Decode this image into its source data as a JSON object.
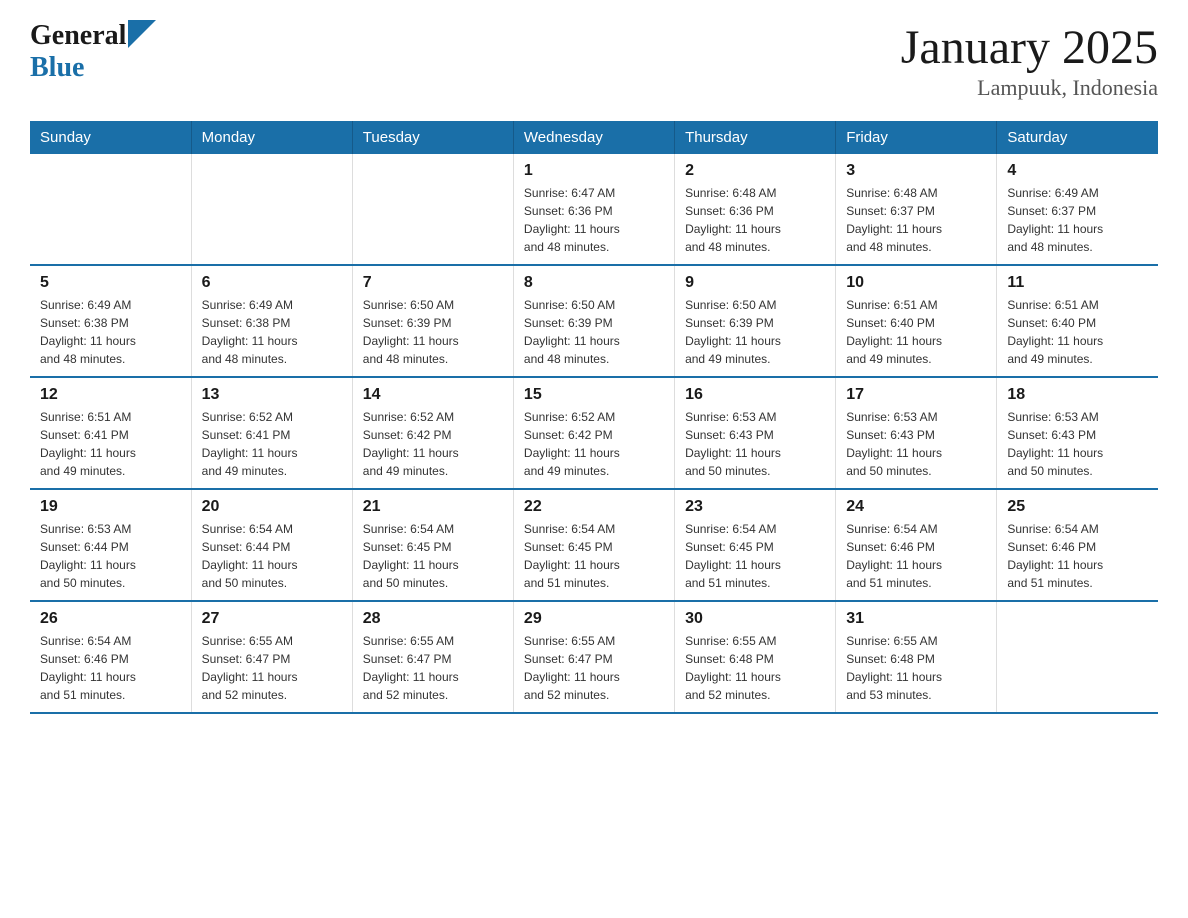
{
  "logo": {
    "general": "General",
    "blue": "Blue"
  },
  "header": {
    "title": "January 2025",
    "subtitle": "Lampuuk, Indonesia"
  },
  "weekdays": [
    "Sunday",
    "Monday",
    "Tuesday",
    "Wednesday",
    "Thursday",
    "Friday",
    "Saturday"
  ],
  "weeks": [
    [
      {
        "day": "",
        "info": ""
      },
      {
        "day": "",
        "info": ""
      },
      {
        "day": "",
        "info": ""
      },
      {
        "day": "1",
        "info": "Sunrise: 6:47 AM\nSunset: 6:36 PM\nDaylight: 11 hours\nand 48 minutes."
      },
      {
        "day": "2",
        "info": "Sunrise: 6:48 AM\nSunset: 6:36 PM\nDaylight: 11 hours\nand 48 minutes."
      },
      {
        "day": "3",
        "info": "Sunrise: 6:48 AM\nSunset: 6:37 PM\nDaylight: 11 hours\nand 48 minutes."
      },
      {
        "day": "4",
        "info": "Sunrise: 6:49 AM\nSunset: 6:37 PM\nDaylight: 11 hours\nand 48 minutes."
      }
    ],
    [
      {
        "day": "5",
        "info": "Sunrise: 6:49 AM\nSunset: 6:38 PM\nDaylight: 11 hours\nand 48 minutes."
      },
      {
        "day": "6",
        "info": "Sunrise: 6:49 AM\nSunset: 6:38 PM\nDaylight: 11 hours\nand 48 minutes."
      },
      {
        "day": "7",
        "info": "Sunrise: 6:50 AM\nSunset: 6:39 PM\nDaylight: 11 hours\nand 48 minutes."
      },
      {
        "day": "8",
        "info": "Sunrise: 6:50 AM\nSunset: 6:39 PM\nDaylight: 11 hours\nand 48 minutes."
      },
      {
        "day": "9",
        "info": "Sunrise: 6:50 AM\nSunset: 6:39 PM\nDaylight: 11 hours\nand 49 minutes."
      },
      {
        "day": "10",
        "info": "Sunrise: 6:51 AM\nSunset: 6:40 PM\nDaylight: 11 hours\nand 49 minutes."
      },
      {
        "day": "11",
        "info": "Sunrise: 6:51 AM\nSunset: 6:40 PM\nDaylight: 11 hours\nand 49 minutes."
      }
    ],
    [
      {
        "day": "12",
        "info": "Sunrise: 6:51 AM\nSunset: 6:41 PM\nDaylight: 11 hours\nand 49 minutes."
      },
      {
        "day": "13",
        "info": "Sunrise: 6:52 AM\nSunset: 6:41 PM\nDaylight: 11 hours\nand 49 minutes."
      },
      {
        "day": "14",
        "info": "Sunrise: 6:52 AM\nSunset: 6:42 PM\nDaylight: 11 hours\nand 49 minutes."
      },
      {
        "day": "15",
        "info": "Sunrise: 6:52 AM\nSunset: 6:42 PM\nDaylight: 11 hours\nand 49 minutes."
      },
      {
        "day": "16",
        "info": "Sunrise: 6:53 AM\nSunset: 6:43 PM\nDaylight: 11 hours\nand 50 minutes."
      },
      {
        "day": "17",
        "info": "Sunrise: 6:53 AM\nSunset: 6:43 PM\nDaylight: 11 hours\nand 50 minutes."
      },
      {
        "day": "18",
        "info": "Sunrise: 6:53 AM\nSunset: 6:43 PM\nDaylight: 11 hours\nand 50 minutes."
      }
    ],
    [
      {
        "day": "19",
        "info": "Sunrise: 6:53 AM\nSunset: 6:44 PM\nDaylight: 11 hours\nand 50 minutes."
      },
      {
        "day": "20",
        "info": "Sunrise: 6:54 AM\nSunset: 6:44 PM\nDaylight: 11 hours\nand 50 minutes."
      },
      {
        "day": "21",
        "info": "Sunrise: 6:54 AM\nSunset: 6:45 PM\nDaylight: 11 hours\nand 50 minutes."
      },
      {
        "day": "22",
        "info": "Sunrise: 6:54 AM\nSunset: 6:45 PM\nDaylight: 11 hours\nand 51 minutes."
      },
      {
        "day": "23",
        "info": "Sunrise: 6:54 AM\nSunset: 6:45 PM\nDaylight: 11 hours\nand 51 minutes."
      },
      {
        "day": "24",
        "info": "Sunrise: 6:54 AM\nSunset: 6:46 PM\nDaylight: 11 hours\nand 51 minutes."
      },
      {
        "day": "25",
        "info": "Sunrise: 6:54 AM\nSunset: 6:46 PM\nDaylight: 11 hours\nand 51 minutes."
      }
    ],
    [
      {
        "day": "26",
        "info": "Sunrise: 6:54 AM\nSunset: 6:46 PM\nDaylight: 11 hours\nand 51 minutes."
      },
      {
        "day": "27",
        "info": "Sunrise: 6:55 AM\nSunset: 6:47 PM\nDaylight: 11 hours\nand 52 minutes."
      },
      {
        "day": "28",
        "info": "Sunrise: 6:55 AM\nSunset: 6:47 PM\nDaylight: 11 hours\nand 52 minutes."
      },
      {
        "day": "29",
        "info": "Sunrise: 6:55 AM\nSunset: 6:47 PM\nDaylight: 11 hours\nand 52 minutes."
      },
      {
        "day": "30",
        "info": "Sunrise: 6:55 AM\nSunset: 6:48 PM\nDaylight: 11 hours\nand 52 minutes."
      },
      {
        "day": "31",
        "info": "Sunrise: 6:55 AM\nSunset: 6:48 PM\nDaylight: 11 hours\nand 53 minutes."
      },
      {
        "day": "",
        "info": ""
      }
    ]
  ]
}
